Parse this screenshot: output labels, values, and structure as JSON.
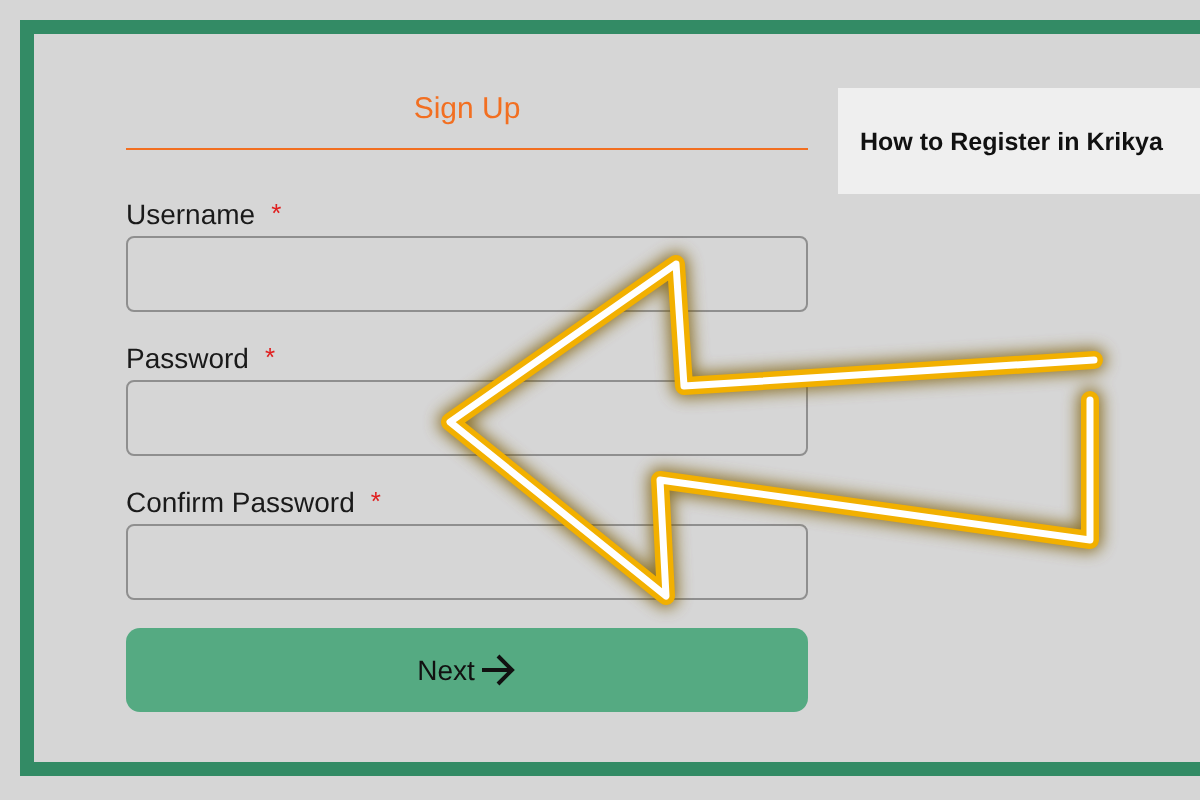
{
  "form": {
    "heading": "Sign Up",
    "fields": [
      {
        "label": "Username",
        "required_mark": "*"
      },
      {
        "label": "Password",
        "required_mark": "*"
      },
      {
        "label": "Confirm Password",
        "required_mark": "*"
      }
    ],
    "button": {
      "label": "Next"
    }
  },
  "side_card": {
    "title": "How to Register in Krikya"
  }
}
